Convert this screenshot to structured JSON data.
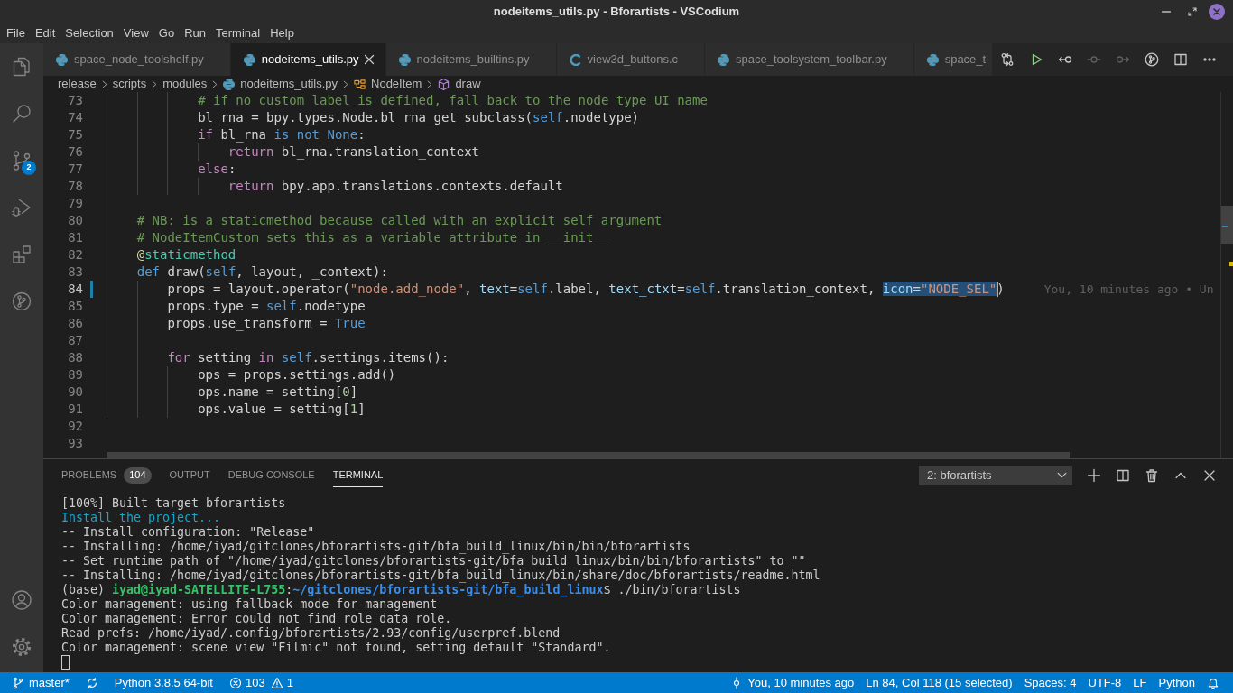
{
  "window": {
    "title": "nodeitems_utils.py - Bforartists - VSCodium"
  },
  "menu": [
    "File",
    "Edit",
    "Selection",
    "View",
    "Go",
    "Run",
    "Terminal",
    "Help"
  ],
  "activity_bar": {
    "top": [
      {
        "kind": "explorer",
        "selected": false
      },
      {
        "kind": "search",
        "selected": false
      },
      {
        "kind": "source_control",
        "selected": false,
        "badge": "2"
      },
      {
        "kind": "debug",
        "selected": false
      },
      {
        "kind": "extensions",
        "selected": false
      },
      {
        "kind": "git_graph",
        "selected": false
      }
    ],
    "bottom": [
      {
        "kind": "account"
      },
      {
        "kind": "settings"
      }
    ]
  },
  "tabs": [
    {
      "label": "space_node_toolshelf.py",
      "kind": "python",
      "selected": false
    },
    {
      "label": "nodeitems_utils.py",
      "kind": "python",
      "selected": true
    },
    {
      "label": "nodeitems_builtins.py",
      "kind": "python",
      "selected": false
    },
    {
      "label": "view3d_buttons.c",
      "kind": "c",
      "selected": false
    },
    {
      "label": "space_toolsystem_toolbar.py",
      "kind": "python",
      "selected": false
    },
    {
      "label": "space_t",
      "kind": "python",
      "selected": false
    }
  ],
  "editor_actions": [
    {
      "kind": "compare",
      "disabled": false
    },
    {
      "kind": "run",
      "disabled": false
    },
    {
      "kind": "back",
      "disabled": false
    },
    {
      "kind": "commit",
      "disabled": true
    },
    {
      "kind": "forward",
      "disabled": true
    },
    {
      "kind": "history",
      "disabled": false
    },
    {
      "kind": "split",
      "disabled": false
    },
    {
      "kind": "more",
      "disabled": false
    }
  ],
  "breadcrumb": [
    {
      "label": "release",
      "kind": "folder"
    },
    {
      "label": "scripts",
      "kind": "folder"
    },
    {
      "label": "modules",
      "kind": "folder"
    },
    {
      "label": "nodeitems_utils.py",
      "kind": "python"
    },
    {
      "label": "NodeItem",
      "kind": "class"
    },
    {
      "label": "draw",
      "kind": "method"
    }
  ],
  "editor": {
    "lines": [
      {
        "number": "73",
        "current": false,
        "modified": false,
        "segments": [
          {
            "kind": "comment",
            "text": "            # if no custom label is defined, fall back to the node type UI name"
          }
        ]
      },
      {
        "number": "74",
        "current": false,
        "modified": false,
        "segments": [
          {
            "kind": "plain",
            "text": "            bl_rna = bpy.types.Node.bl_rna_get_subclass("
          },
          {
            "kind": "keyword",
            "text": "self"
          },
          {
            "kind": "plain",
            "text": ".nodetype)"
          }
        ]
      },
      {
        "number": "75",
        "current": false,
        "modified": false,
        "segments": [
          {
            "kind": "control",
            "text": "            if"
          },
          {
            "kind": "plain",
            "text": " bl_rna "
          },
          {
            "kind": "keyword",
            "text": "is not None"
          },
          {
            "kind": "plain",
            "text": ":"
          }
        ]
      },
      {
        "number": "76",
        "current": false,
        "modified": false,
        "segments": [
          {
            "kind": "control",
            "text": "                return"
          },
          {
            "kind": "plain",
            "text": " bl_rna.translation_context"
          }
        ]
      },
      {
        "number": "77",
        "current": false,
        "modified": false,
        "segments": [
          {
            "kind": "control",
            "text": "            else"
          },
          {
            "kind": "plain",
            "text": ":"
          }
        ]
      },
      {
        "number": "78",
        "current": false,
        "modified": false,
        "segments": [
          {
            "kind": "control",
            "text": "                return"
          },
          {
            "kind": "plain",
            "text": " bpy.app.translations.contexts.default"
          }
        ]
      },
      {
        "number": "79",
        "current": false,
        "modified": false
      },
      {
        "number": "80",
        "current": false,
        "modified": false,
        "segments": [
          {
            "kind": "comment",
            "text": "    # NB: is a staticmethod because called with an explicit self argument"
          }
        ]
      },
      {
        "number": "81",
        "current": false,
        "modified": false,
        "segments": [
          {
            "kind": "comment",
            "text": "    # NodeItemCustom sets this as a variable attribute in __init__"
          }
        ]
      },
      {
        "number": "82",
        "current": false,
        "modified": false,
        "segments": [
          {
            "kind": "decorator",
            "text": "    @"
          },
          {
            "kind": "builtin",
            "text": "staticmethod"
          }
        ]
      },
      {
        "number": "83",
        "current": false,
        "modified": false,
        "segments": [
          {
            "kind": "keyword",
            "text": "    def"
          },
          {
            "kind": "plain",
            "text": " draw("
          },
          {
            "kind": "keyword",
            "text": "self"
          },
          {
            "kind": "plain",
            "text": ", layout, _context):"
          }
        ]
      },
      {
        "number": "84",
        "current": true,
        "modified": true,
        "blame": "You, 10 minutes ago • Un",
        "segments": [
          {
            "kind": "plain",
            "text": "        props = layout.operator("
          },
          {
            "kind": "string",
            "text": "\"node.add_node\""
          },
          {
            "kind": "plain",
            "text": ", "
          },
          {
            "kind": "param",
            "text": "text"
          },
          {
            "kind": "plain",
            "text": "="
          },
          {
            "kind": "keyword",
            "text": "self"
          },
          {
            "kind": "plain",
            "text": ".label, "
          },
          {
            "kind": "param",
            "text": "text_ctxt"
          },
          {
            "kind": "plain",
            "text": "="
          },
          {
            "kind": "keyword",
            "text": "self"
          },
          {
            "kind": "plain",
            "text": ".translation_context, "
          },
          {
            "kind": "selection",
            "segments": [
              {
                "kind": "param",
                "text": "icon"
              },
              {
                "kind": "plain",
                "text": "="
              },
              {
                "kind": "string",
                "text": "\"NODE_SEL\""
              }
            ]
          },
          {
            "kind": "plain",
            "text": ")"
          }
        ]
      },
      {
        "number": "85",
        "current": false,
        "modified": false,
        "segments": [
          {
            "kind": "plain",
            "text": "        props.type = "
          },
          {
            "kind": "keyword",
            "text": "self"
          },
          {
            "kind": "plain",
            "text": ".nodetype"
          }
        ]
      },
      {
        "number": "86",
        "current": false,
        "modified": false,
        "segments": [
          {
            "kind": "plain",
            "text": "        props.use_transform = "
          },
          {
            "kind": "keyword",
            "text": "True"
          }
        ]
      },
      {
        "number": "87",
        "current": false,
        "modified": false
      },
      {
        "number": "88",
        "current": false,
        "modified": false,
        "segments": [
          {
            "kind": "control",
            "text": "        for"
          },
          {
            "kind": "plain",
            "text": " setting "
          },
          {
            "kind": "control",
            "text": "in"
          },
          {
            "kind": "keyword",
            "text": " self"
          },
          {
            "kind": "plain",
            "text": ".settings.items():"
          }
        ]
      },
      {
        "number": "89",
        "current": false,
        "modified": false,
        "segments": [
          {
            "kind": "plain",
            "text": "            ops = props.settings.add()"
          }
        ]
      },
      {
        "number": "90",
        "current": false,
        "modified": false,
        "segments": [
          {
            "kind": "plain",
            "text": "            ops.name = setting["
          },
          {
            "kind": "number",
            "text": "0"
          },
          {
            "kind": "plain",
            "text": "]"
          }
        ]
      },
      {
        "number": "91",
        "current": false,
        "modified": false,
        "segments": [
          {
            "kind": "plain",
            "text": "            ops.value = setting["
          },
          {
            "kind": "number",
            "text": "1"
          },
          {
            "kind": "plain",
            "text": "]"
          }
        ]
      },
      {
        "number": "92",
        "current": false,
        "modified": false
      },
      {
        "number": "93",
        "current": false,
        "modified": false
      }
    ]
  },
  "panel": {
    "tabs": [
      {
        "label": "PROBLEMS",
        "badge": "104",
        "selected": false
      },
      {
        "label": "OUTPUT",
        "selected": false
      },
      {
        "label": "DEBUG CONSOLE",
        "selected": false
      },
      {
        "label": "TERMINAL",
        "selected": true
      }
    ],
    "terminal_dropdown": {
      "value": "2: bforartists"
    },
    "actions": [
      {
        "kind": "new"
      },
      {
        "kind": "split"
      },
      {
        "kind": "kill"
      },
      {
        "kind": "maximize"
      },
      {
        "kind": "close"
      }
    ],
    "terminal": {
      "lines": [
        {
          "kind": "output",
          "segments": [
            {
              "kind": "plain",
              "text": "[100%] Built target bforartists"
            }
          ]
        },
        {
          "kind": "output",
          "segments": [
            {
              "kind": "info",
              "text": "Install the project..."
            }
          ]
        },
        {
          "kind": "output",
          "segments": [
            {
              "kind": "plain",
              "text": "-- Install configuration: \"Release\""
            }
          ]
        },
        {
          "kind": "output",
          "segments": [
            {
              "kind": "plain",
              "text": "-- Installing: /home/iyad/gitclones/bforartists-git/bfa_build_linux/bin/bin/bforartists"
            }
          ]
        },
        {
          "kind": "output",
          "segments": [
            {
              "kind": "plain",
              "text": "-- Set runtime path of \"/home/iyad/gitclones/bforartists-git/bfa_build_linux/bin/bin/bforartists\" to \"\""
            }
          ]
        },
        {
          "kind": "output",
          "segments": [
            {
              "kind": "plain",
              "text": "-- Installing: /home/iyad/gitclones/bforartists-git/bfa_build_linux/bin/share/doc/bforartists/readme.html"
            }
          ]
        },
        {
          "kind": "output",
          "segments": [
            {
              "kind": "plain",
              "text": "(base) "
            },
            {
              "kind": "user",
              "text": "iyad@iyad-SATELLITE-L755"
            },
            {
              "kind": "plain",
              "text": ":"
            },
            {
              "kind": "path",
              "text": "~/gitclones/bforartists-git/bfa_build_linux"
            },
            {
              "kind": "plain",
              "text": "$ ./bin/bforartists"
            }
          ]
        },
        {
          "kind": "output",
          "segments": [
            {
              "kind": "plain",
              "text": "Color management: using fallback mode for management"
            }
          ]
        },
        {
          "kind": "output",
          "segments": [
            {
              "kind": "plain",
              "text": "Color management: Error could not find role data role."
            }
          ]
        },
        {
          "kind": "output",
          "segments": [
            {
              "kind": "plain",
              "text": "Read prefs: /home/iyad/.config/bforartists/2.93/config/userpref.blend"
            }
          ]
        },
        {
          "kind": "output",
          "segments": [
            {
              "kind": "plain",
              "text": "Color management: scene view \"Filmic\" not found, setting default \"Standard\"."
            }
          ]
        },
        {
          "kind": "cursor"
        }
      ]
    }
  },
  "status_bar": {
    "left": [
      {
        "kind": "branch",
        "text": "master*"
      },
      {
        "kind": "sync"
      },
      {
        "kind": "interpreter",
        "text": "Python 3.8.5 64-bit"
      },
      {
        "kind": "problems",
        "errors": "103",
        "warnings": "1"
      }
    ],
    "right": [
      {
        "kind": "blame",
        "text": "You, 10 minutes ago"
      },
      {
        "kind": "position",
        "text": "Ln 84, Col 118 (15 selected)"
      },
      {
        "kind": "indentation",
        "text": "Spaces: 4"
      },
      {
        "kind": "encoding",
        "text": "UTF-8"
      },
      {
        "kind": "eol",
        "text": "LF"
      },
      {
        "kind": "language",
        "text": "Python"
      },
      {
        "kind": "notifications"
      }
    ]
  }
}
